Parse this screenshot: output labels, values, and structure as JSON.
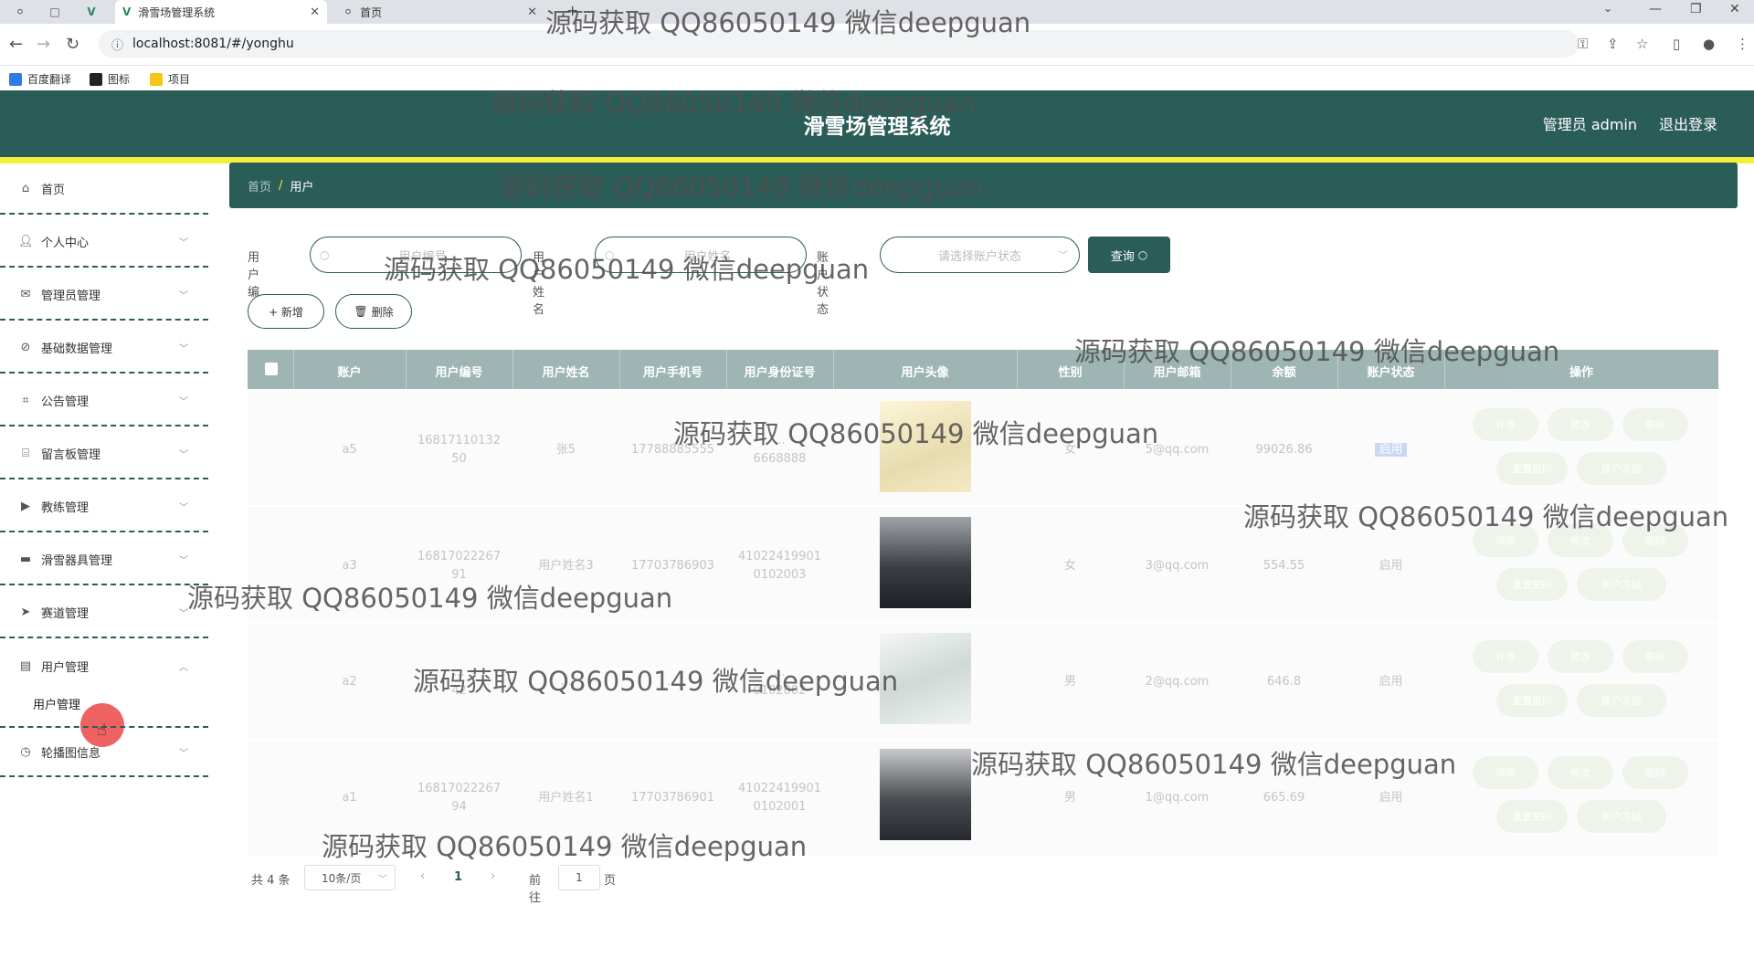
{
  "browser": {
    "tabs": [
      {
        "label": "滑雪场管理系统"
      },
      {
        "label": "首页"
      }
    ],
    "url": "localhost:8081/#/yonghu",
    "bookmarks": [
      {
        "label": "百度翻译"
      },
      {
        "label": "图标"
      },
      {
        "label": "项目"
      }
    ]
  },
  "header": {
    "title": "滑雪场管理系统",
    "user": "管理员 admin",
    "logout": "退出登录"
  },
  "sidebar": {
    "items": [
      {
        "label": "首页",
        "icon": "home-icon"
      },
      {
        "label": "个人中心",
        "icon": "user-icon"
      },
      {
        "label": "管理员管理",
        "icon": "mail-icon"
      },
      {
        "label": "基础数据管理",
        "icon": "compass-icon"
      },
      {
        "label": "公告管理",
        "icon": "crop-icon"
      },
      {
        "label": "留言板管理",
        "icon": "bank-icon"
      },
      {
        "label": "教练管理",
        "icon": "video-icon"
      },
      {
        "label": "滑雪器具管理",
        "icon": "monitor-icon"
      },
      {
        "label": "赛道管理",
        "icon": "send-icon"
      },
      {
        "label": "用户管理",
        "icon": "clipboard-icon"
      },
      {
        "label": "轮播图信息",
        "icon": "clock-icon"
      }
    ],
    "submenu": {
      "label": "用户管理"
    }
  },
  "breadcrumb": {
    "home": "首页",
    "separator": "/",
    "current": "用户"
  },
  "search": {
    "user_no_label": "用户编号",
    "user_no_placeholder": "用户编号",
    "user_name_label": "用户姓名",
    "user_name_placeholder": "用户姓名",
    "status_label": "账户状态",
    "status_placeholder": "请选择账户状态",
    "query_label": "查询"
  },
  "actions": {
    "add_label": "+ 新增",
    "delete_label": "删除"
  },
  "table": {
    "columns": [
      "账户",
      "用户编号",
      "用户姓名",
      "用户手机号",
      "用户身份证号",
      "用户头像",
      "性别",
      "用户邮箱",
      "余额",
      "账户状态",
      "操作"
    ],
    "rows": [
      {
        "account": "a5",
        "user_no": "16817110132\n50",
        "name": "张5",
        "phone": "17788885555",
        "id_card": "...\n6668888",
        "gender": "女",
        "email": "5@qq.com",
        "balance": "99026.86",
        "status": "启用"
      },
      {
        "account": "a3",
        "user_no": "16817022267\n91",
        "name": "用户姓名3",
        "phone": "17703786903",
        "id_card": "41022419901\n0102003",
        "gender": "女",
        "email": "3@qq.com",
        "balance": "554.55",
        "status": "启用"
      },
      {
        "account": "a2",
        "user_no": "...\n42",
        "name": "...",
        "phone": "...",
        "id_card": "...\n0102002",
        "gender": "男",
        "email": "2@qq.com",
        "balance": "646.8",
        "status": "启用"
      },
      {
        "account": "a1",
        "user_no": "16817022267\n94",
        "name": "用户姓名1",
        "phone": "17703786901",
        "id_card": "41022419901\n0102001",
        "gender": "男",
        "email": "1@qq.com",
        "balance": "665.69",
        "status": "启用"
      }
    ],
    "op_labels": [
      "详情",
      "修改",
      "删除",
      "重置密码",
      "账户冻结"
    ]
  },
  "pagination": {
    "total": "共 4 条",
    "page_size": "10条/页",
    "current_page": "1",
    "goto_label": "前往",
    "goto_value": "1",
    "page_suffix": "页"
  },
  "watermark": "源码获取 QQ86050149 微信deepguan",
  "colors": {
    "primary": "#2b5d58",
    "accent": "#f3ee3a"
  }
}
